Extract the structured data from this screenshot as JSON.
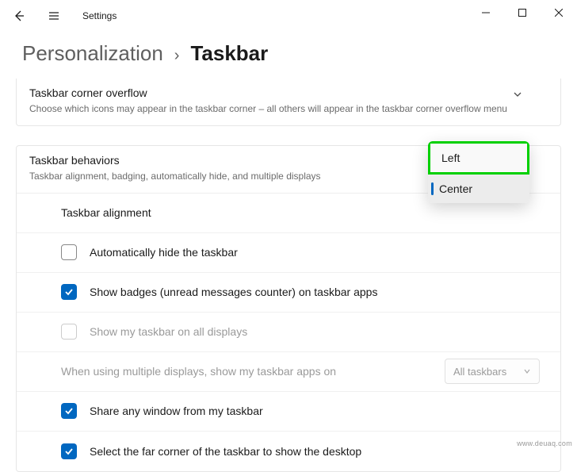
{
  "titlebar": {
    "title": "Settings"
  },
  "breadcrumb": {
    "parent": "Personalization",
    "separator": "›",
    "current": "Taskbar"
  },
  "overflow": {
    "title": "Taskbar corner overflow",
    "desc": "Choose which icons may appear in the taskbar corner – all others will appear in the taskbar corner overflow menu"
  },
  "behaviors": {
    "title": "Taskbar behaviors",
    "desc": "Taskbar alignment, badging, automatically hide, and multiple displays",
    "alignment_label": "Taskbar alignment",
    "rows": {
      "auto_hide": "Automatically hide the taskbar",
      "badges": "Show badges (unread messages counter) on taskbar apps",
      "all_displays": "Show my taskbar on all displays",
      "multi_label": "When using multiple displays, show my taskbar apps on",
      "multi_value": "All taskbars",
      "share": "Share any window from my taskbar",
      "corner_desktop": "Select the far corner of the taskbar to show the desktop"
    }
  },
  "dropdown": {
    "options": {
      "left": "Left",
      "center": "Center"
    }
  },
  "watermark": "www.deuaq.com"
}
